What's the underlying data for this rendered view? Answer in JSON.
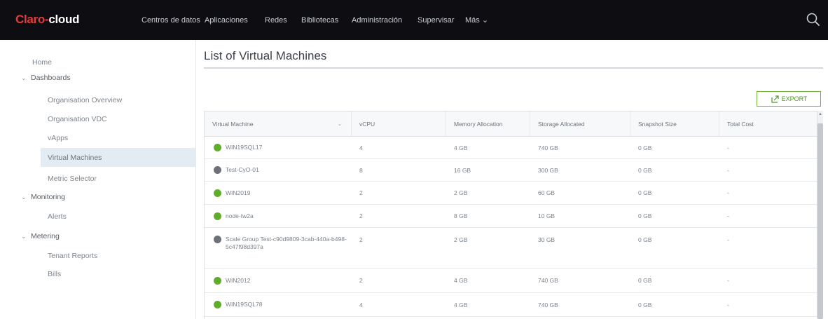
{
  "app": {
    "logo_brand": "Claro",
    "logo_sep": "-",
    "logo_product": "cloud"
  },
  "nav": {
    "items": [
      "Centros de datos",
      "Aplicaciones",
      "Redes",
      "Bibliotecas",
      "Administración",
      "Supervisar",
      "Más ⌄"
    ]
  },
  "sidebar": {
    "home": "Home",
    "dashboards": "Dashboards",
    "dashboard_items": [
      "Organisation Overview",
      "Organisation VDC",
      "vApps",
      "Virtual Machines",
      "Metric Selector"
    ],
    "monitoring": "Monitoring",
    "monitoring_items": [
      "Alerts"
    ],
    "metering": "Metering",
    "metering_items": [
      "Tenant Reports",
      "Bills"
    ]
  },
  "main": {
    "title": "List of Virtual Machines",
    "export_label": "EXPORT"
  },
  "table": {
    "headers": [
      "Virtual Machine",
      "vCPU",
      "Memory Allocation",
      "Storage Allocated",
      "Snapshot Size",
      "Total Cost"
    ],
    "rows": [
      {
        "status": "on",
        "name": "WIN19SQL17",
        "vcpu": "4",
        "memory": "4 GB",
        "storage": "740 GB",
        "snapshot": "0 GB",
        "cost": "-"
      },
      {
        "status": "off",
        "name": "Test-CyO-01",
        "vcpu": "8",
        "memory": "16 GB",
        "storage": "300 GB",
        "snapshot": "0 GB",
        "cost": "-"
      },
      {
        "status": "on",
        "name": "WIN2019",
        "vcpu": "2",
        "memory": "2 GB",
        "storage": "60 GB",
        "snapshot": "0 GB",
        "cost": "-"
      },
      {
        "status": "on",
        "name": "node-tw2a",
        "vcpu": "2",
        "memory": "8 GB",
        "storage": "10 GB",
        "snapshot": "0 GB",
        "cost": "-"
      },
      {
        "status": "off",
        "name": "Scale Group Test-c90d9809-3cab-440a-b498-5c47f98d397a",
        "vcpu": "2",
        "memory": "2 GB",
        "storage": "30 GB",
        "snapshot": "0 GB",
        "cost": "-"
      },
      {
        "status": "on",
        "name": "WIN2012",
        "vcpu": "2",
        "memory": "4 GB",
        "storage": "740 GB",
        "snapshot": "0 GB",
        "cost": "-"
      },
      {
        "status": "on",
        "name": "WIN19SQL78",
        "vcpu": "4",
        "memory": "4 GB",
        "storage": "740 GB",
        "snapshot": "0 GB",
        "cost": "-"
      }
    ]
  },
  "colors": {
    "topbar": "#0e0e12",
    "brand_red": "#e53b3b",
    "status_on": "#5fae2a",
    "status_off": "#6c7278",
    "export_green": "#4f9a21",
    "active_item": "#e3ebf3"
  },
  "icons": {
    "search": "search-icon",
    "export": "export-icon",
    "chevron": "chevron-down-icon",
    "sort": "sort-icon"
  }
}
